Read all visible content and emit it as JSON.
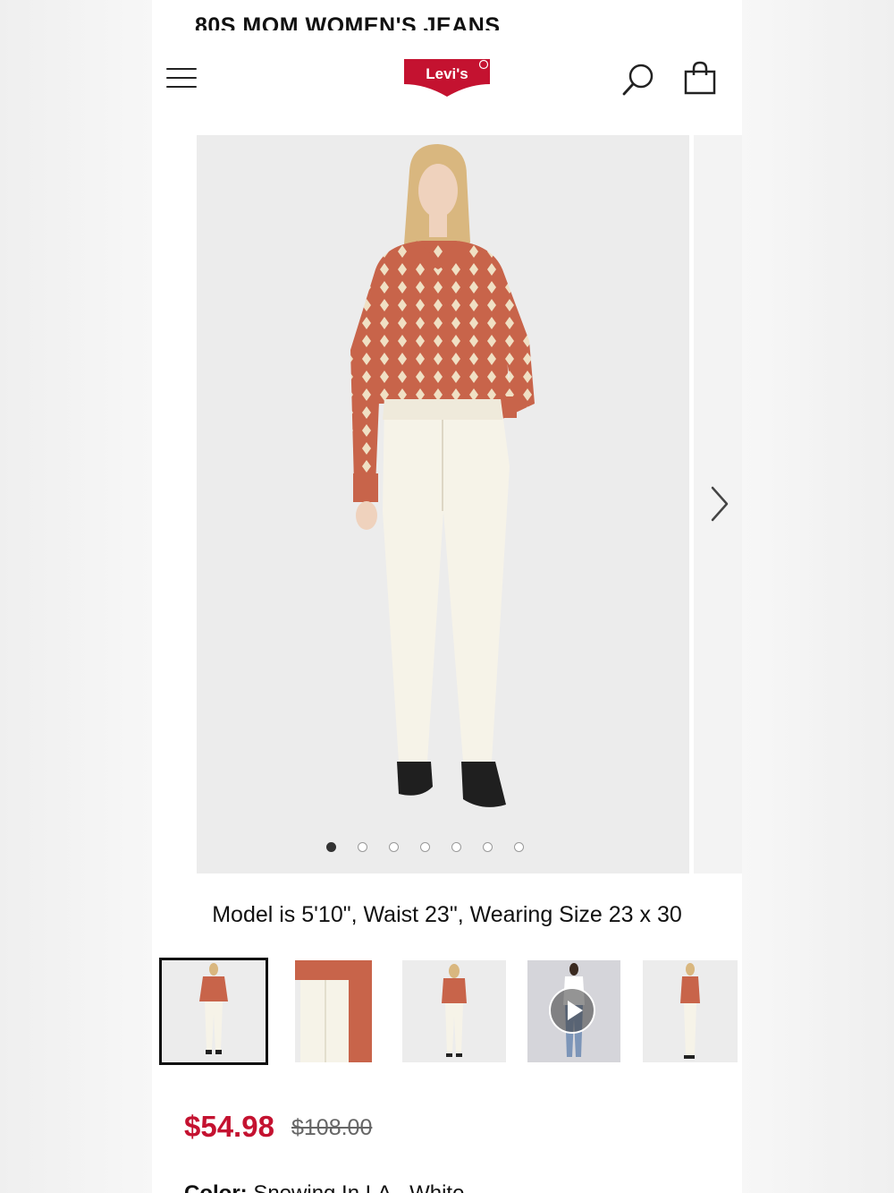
{
  "page": {
    "title": "80S MOM WOMEN'S JEANS"
  },
  "header": {
    "menu_icon": "hamburger-menu-icon",
    "logo_text": "Levi's",
    "search_icon": "search-icon",
    "bag_icon": "shopping-bag-icon",
    "brand_color": "#c41230"
  },
  "gallery": {
    "image": "model wearing white 80s mom jeans and orange diamond-pattern polo sweater",
    "total_images": 7,
    "active_index": 0,
    "next_icon": "chevron-right-icon"
  },
  "product": {
    "model_info": "Model is 5'10\", Waist 23\", Wearing Size 23 x 30",
    "sale_price": "$54.98",
    "original_price": "$108.00",
    "color_label": "Color:",
    "color_value": "Snowing In LA - White"
  },
  "thumbnails": [
    {
      "label": "front full view",
      "selected": true
    },
    {
      "label": "detail close-up",
      "selected": false
    },
    {
      "label": "back full view",
      "selected": false
    },
    {
      "label": "video",
      "selected": false,
      "is_video": true
    },
    {
      "label": "side full view",
      "selected": false
    }
  ]
}
